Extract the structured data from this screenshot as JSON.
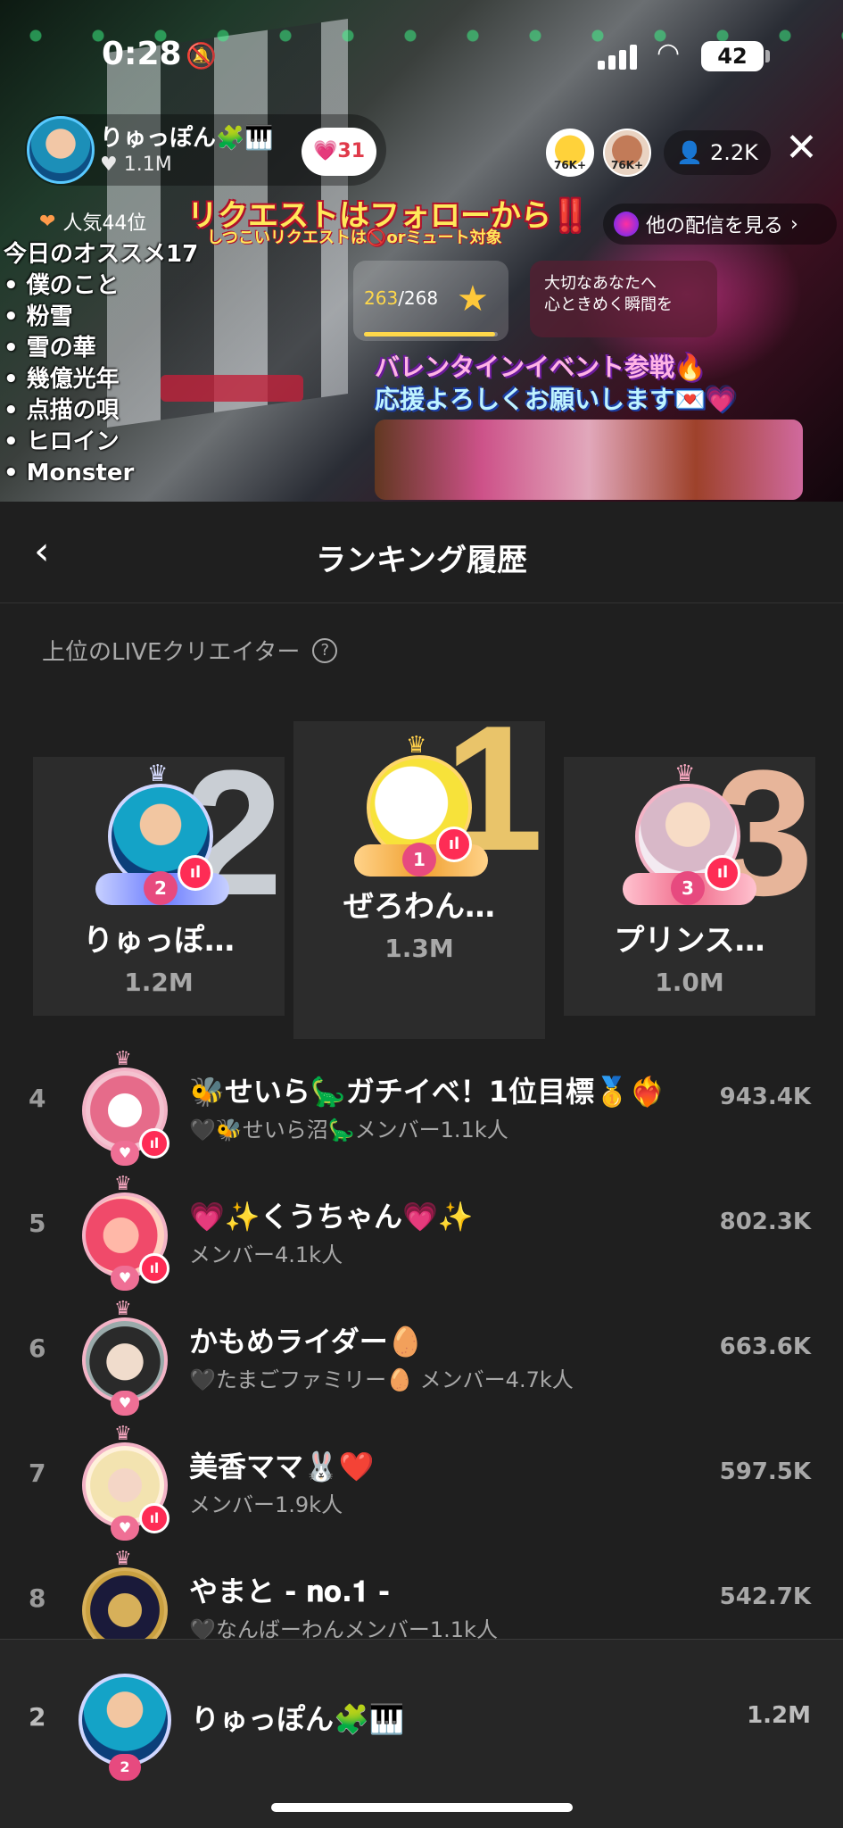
{
  "status_bar": {
    "time": "0:28",
    "battery": "42"
  },
  "stream": {
    "host_name": "りゅっぽん🧩🎹",
    "host_likes": "1.1M",
    "gift_count": "31",
    "viewer_avatars": [
      {
        "label": "76K+"
      },
      {
        "label": "76K+"
      }
    ],
    "viewer_count": "2.2K",
    "popularity": "人気44位",
    "request_banner": "リクエストはフォローから‼️",
    "request_sub": "しつこいリクエストは🚫orミュート対象",
    "other_streams": "他の配信を見る",
    "recs_title": "今日のオススメ17",
    "recs": [
      "僕のこと",
      "粉雪",
      "雪の華",
      "幾億光年",
      "点描の唄",
      "ヒロイン",
      "Monster"
    ],
    "goal_current": "263",
    "goal_total": "/268",
    "goal_progress": 0.98,
    "msg_line1": "大切なあなたへ",
    "msg_line2": "心ときめく瞬間を",
    "valentine_line1": "バレンタインイベント参戦🔥",
    "valentine_line2": "応援よろしくお願いします💌💗"
  },
  "sheet": {
    "title": "ランキング履歴",
    "section_label": "上位のLIVEクリエイター",
    "podium": [
      {
        "rank": "1",
        "name": "ぜろわん…",
        "score": "1.3M"
      },
      {
        "rank": "2",
        "name": "りゅっぽ…",
        "score": "1.2M"
      },
      {
        "rank": "3",
        "name": "プリンス…",
        "score": "1.0M"
      }
    ],
    "rows": [
      {
        "rank": "4",
        "name": "🐝せいら🦕ガチイベ！1位目標🥇❤️‍🔥",
        "sub": "🖤🐝せいら沼🦕メンバー1.1k人",
        "score": "943.4K"
      },
      {
        "rank": "5",
        "name": "💗✨くうちゃん💗✨",
        "sub": "メンバー4.1k人",
        "score": "802.3K"
      },
      {
        "rank": "6",
        "name": "かもめライダー🥚",
        "sub": "🖤たまごファミリー🥚 メンバー4.7k人",
        "score": "663.6K"
      },
      {
        "rank": "7",
        "name": "美香ママ🐰❤️",
        "sub": "メンバー1.9k人",
        "score": "597.5K"
      },
      {
        "rank": "8",
        "name": "やまと - 𝐧𝐨.𝟏 -",
        "sub": "🖤なんばーわんメンバー1.1k人",
        "score": "542.7K"
      }
    ],
    "me": {
      "rank": "2",
      "name": "りゅっぽん🧩🎹",
      "score": "1.2M"
    }
  }
}
